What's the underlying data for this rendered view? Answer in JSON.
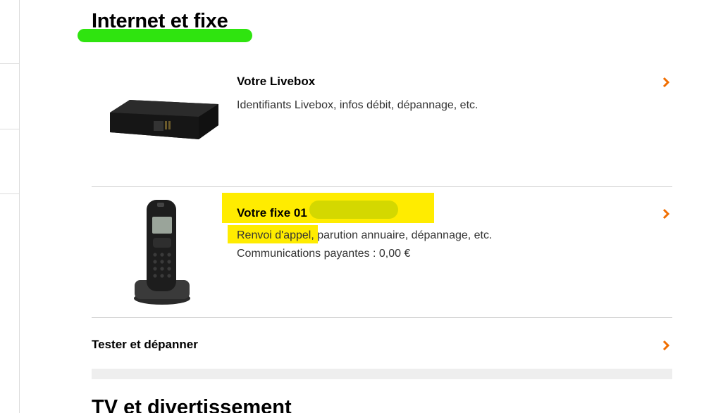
{
  "section": {
    "title": "Internet et fixe",
    "next_title": "TV et divertissement"
  },
  "items": [
    {
      "title": "Votre Livebox",
      "description": "Identifiants Livebox, infos débit, dépannage, etc.",
      "image": "livebox-device"
    },
    {
      "title": "Votre fixe 01",
      "description_highlighted": "Renvoi d'appel,",
      "description_rest": " parution annuaire, dépannage, etc.",
      "extra": "Communications payantes : 0,00 €",
      "image": "cordless-phone"
    },
    {
      "title": "Tester et dépanner"
    }
  ],
  "colors": {
    "accent_chevron": "#f16e00",
    "green_highlight": "#2fe40f",
    "yellow_highlight": "#ffec00",
    "redaction": "#d4d800"
  },
  "icons": {
    "chevron": "chevron-right-icon"
  }
}
